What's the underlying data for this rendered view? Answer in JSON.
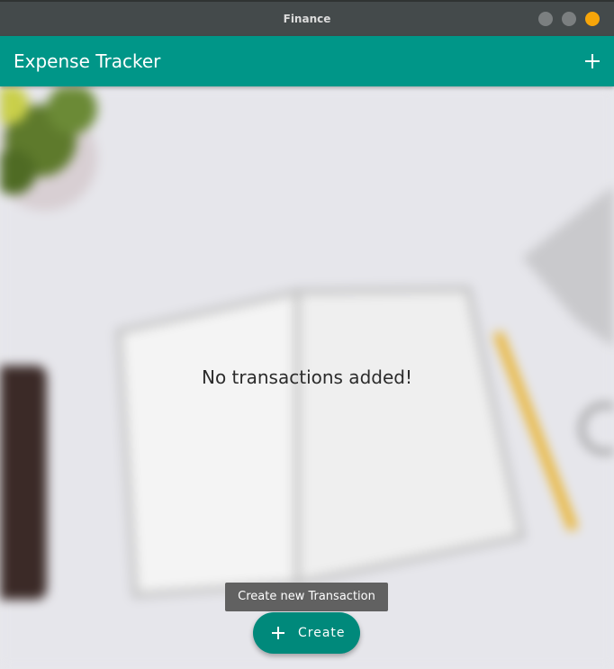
{
  "window": {
    "title": "Finance"
  },
  "appbar": {
    "title": "Expense Tracker",
    "add_icon": "plus-icon"
  },
  "main": {
    "empty_message": "No transactions added!"
  },
  "fab": {
    "tooltip": "Create new Transaction",
    "label": "Create",
    "icon": "plus-icon"
  },
  "colors": {
    "appbar": "#009688",
    "fab": "#00897b",
    "titlebar": "#444a4b",
    "close_button": "#f6a50a",
    "tooltip": "#616161"
  }
}
